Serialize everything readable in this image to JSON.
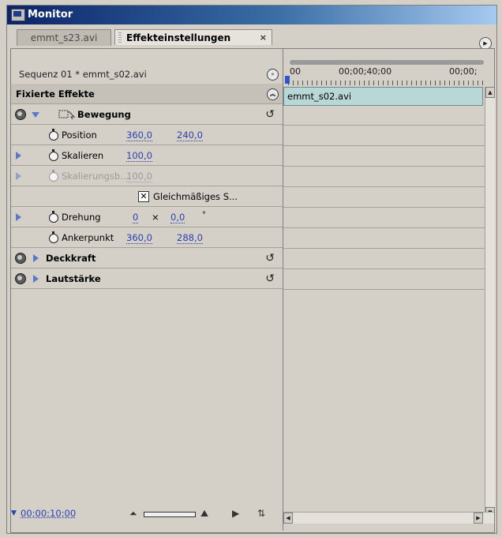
{
  "window": {
    "title": "Monitor"
  },
  "tabs": [
    {
      "label": "emmt_s23.avi"
    },
    {
      "label": "Effekteinstellungen",
      "close": "×"
    }
  ],
  "sequence": {
    "label": "Sequenz 01 * emmt_s02.avi"
  },
  "section_header": "Fixierte Effekte",
  "effects": {
    "bewegung": {
      "label": "Bewegung",
      "position": {
        "label": "Position",
        "x": "360,0",
        "y": "240,0"
      },
      "skalieren": {
        "label": "Skalieren",
        "value": "100,0"
      },
      "skalierungsbreite": {
        "label": "Skalierungsb...",
        "value": "100,0"
      },
      "gleichmaessig": {
        "label": "Gleichmäßiges S...",
        "checked": true
      },
      "drehung": {
        "label": "Drehung",
        "turns": "0",
        "times": "×",
        "degrees": "0,0",
        "degree_sign": "°"
      },
      "ankerpunkt": {
        "label": "Ankerpunkt",
        "x": "360,0",
        "y": "288,0"
      }
    },
    "deckkraft": {
      "label": "Deckkraft"
    },
    "lautstaerke": {
      "label": "Lautstärke"
    }
  },
  "timeline": {
    "start": "00",
    "mid": "00;00;40;00",
    "end": "00;00;",
    "clip_name": "emmt_s02.avi"
  },
  "footer": {
    "timecode": "00;00;10;00"
  },
  "colors": {
    "accent_blue": "#2a3fb0",
    "clip_bg": "#b9d7d7",
    "titlebar_start": "#0a246a"
  }
}
